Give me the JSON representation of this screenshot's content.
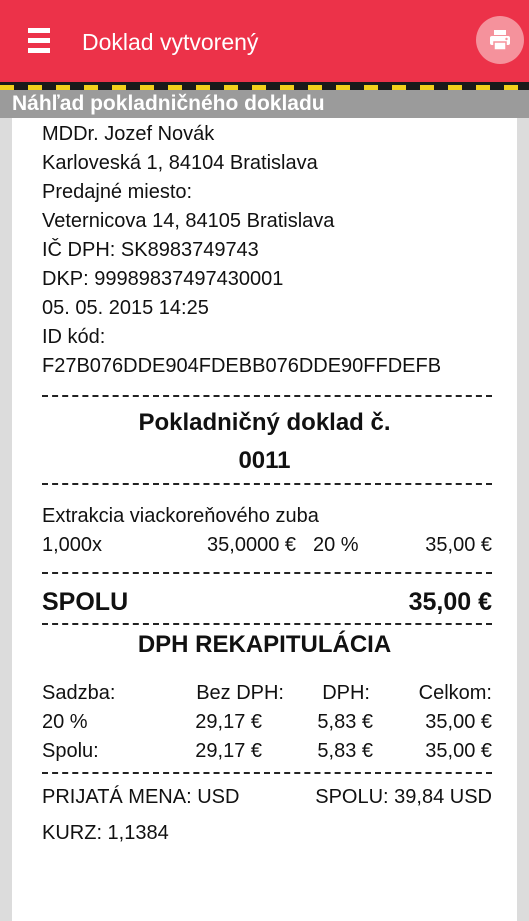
{
  "appbar": {
    "title": "Doklad vytvorený",
    "menu_icon": "hamburger-menu-icon",
    "print_icon": "printer-icon",
    "accent_color": "#ec3249"
  },
  "section_title": "Náhľad pokladničného dokladu",
  "receipt": {
    "header_lines": [
      "MDDr. Jozef Novák",
      "Karloveská 1, 84104 Bratislava",
      "Predajné miesto:",
      "Veternicova  14, 84105 Bratislava",
      "IČ DPH:  SK8983749743",
      "DKP:  99989837497430001",
      "05. 05. 2015 14:25",
      "ID kód:",
      "F27B076DDE904FDEBB076DDE90FFDEFB"
    ],
    "doc_title": "Pokladničný doklad č.",
    "doc_number": "0011",
    "item": {
      "name": "Extrakcia viackoreňového zuba",
      "qty": "1,000x",
      "unit_price": "35,0000 €",
      "vat": "20 %",
      "total": "35,00 €"
    },
    "total_label": "SPOLU",
    "total_value": "35,00 €",
    "vat_title": "DPH REKAPITULÁCIA",
    "vat_headers": [
      "Sadzba:",
      "Bez DPH:",
      "DPH:",
      "Celkom:"
    ],
    "vat_rows": [
      [
        "20 %",
        "29,17 €",
        "5,83 €",
        "35,00 €"
      ],
      [
        "Spolu:",
        "29,17 €",
        "5,83 €",
        "35,00 €"
      ]
    ],
    "currency_label": "PRIJATÁ MENA:  USD",
    "currency_total": "SPOLU:  39,84 USD",
    "rate": "KURZ:  1,1384"
  }
}
